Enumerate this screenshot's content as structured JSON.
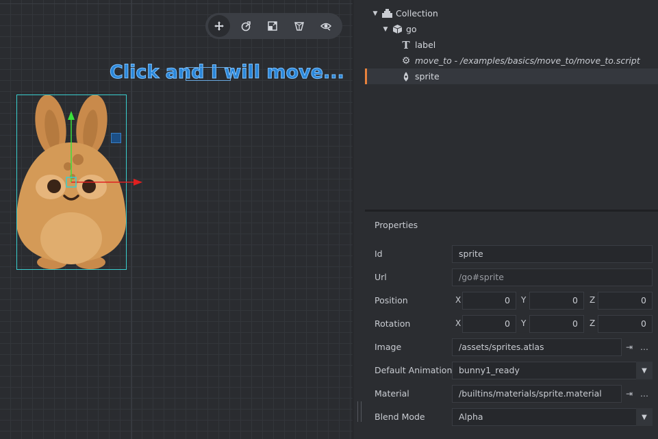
{
  "scene": {
    "label_text": "Click and I will move..."
  },
  "toolbar": {
    "tools": [
      {
        "name": "move-tool",
        "active": true
      },
      {
        "name": "rotate-tool",
        "active": false
      },
      {
        "name": "scale-tool",
        "active": false
      },
      {
        "name": "perspective-tool",
        "active": false
      },
      {
        "name": "visibility-tool",
        "active": false
      }
    ]
  },
  "outline": {
    "items": [
      {
        "label": "Collection",
        "icon": "collection-icon",
        "expanded": true
      },
      {
        "label": "go",
        "icon": "game-object-icon",
        "expanded": true
      },
      {
        "label": "label",
        "icon": "text-icon"
      },
      {
        "label": "move_to - /examples/basics/move_to/move_to.script",
        "icon": "gear-icon"
      },
      {
        "label": "sprite",
        "icon": "sprite-icon",
        "selected": true
      }
    ]
  },
  "properties": {
    "title": "Properties",
    "id": {
      "label": "Id",
      "value": "sprite"
    },
    "url": {
      "label": "Url",
      "value": "/go#sprite"
    },
    "position": {
      "label": "Position",
      "x_label": "X",
      "y_label": "Y",
      "z_label": "Z",
      "x": "0",
      "y": "0",
      "z": "0"
    },
    "rotation": {
      "label": "Rotation",
      "x_label": "X",
      "y_label": "Y",
      "z_label": "Z",
      "x": "0",
      "y": "0",
      "z": "0"
    },
    "image": {
      "label": "Image",
      "value": "/assets/sprites.atlas",
      "goto": "⇥",
      "browse": "…"
    },
    "default_animation": {
      "label": "Default Animation",
      "value": "bunny1_ready"
    },
    "material": {
      "label": "Material",
      "value": "/builtins/materials/sprite.material",
      "goto": "⇥",
      "browse": "…"
    },
    "blend_mode": {
      "label": "Blend Mode",
      "value": "Alpha"
    }
  },
  "colors": {
    "accent": "#e8823c",
    "label_text": "#2b86d8",
    "bounds": "#3ad0d0",
    "x_axis": "#e02020",
    "y_axis": "#3ce03c"
  }
}
